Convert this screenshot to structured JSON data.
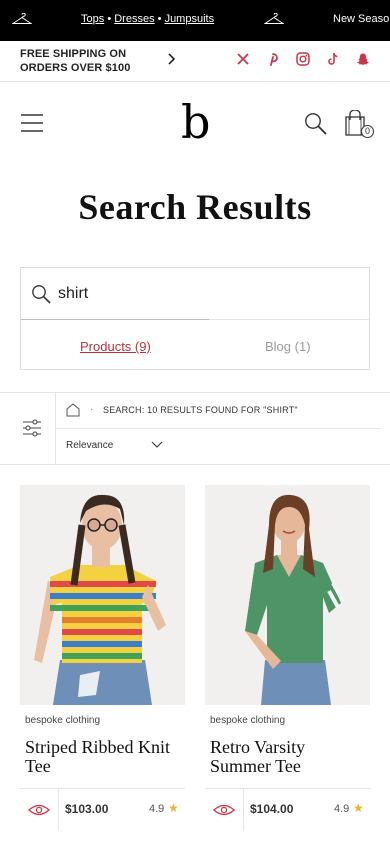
{
  "ticker": {
    "links": [
      "Tops",
      "Dresses",
      "Jumpsuits"
    ],
    "separator": "•",
    "next_text": "New Season"
  },
  "shipping": {
    "line1": "FREE SHIPPING ON",
    "line2": "ORDERS OVER $100"
  },
  "social": [
    "x-icon",
    "pinterest-icon",
    "instagram-icon",
    "tiktok-icon",
    "snapchat-icon"
  ],
  "header": {
    "logo": "b",
    "bag_count": "0"
  },
  "page": {
    "title": "Search Results"
  },
  "search": {
    "value": "shirt",
    "tabs": [
      {
        "label": "Products (9)",
        "active": true
      },
      {
        "label": "Blog (1)",
        "active": false
      }
    ]
  },
  "filter": {
    "breadcrumb_separator": "·",
    "breadcrumb": "SEARCH: 10 RESULTS FOUND FOR \"SHIRT\"",
    "sort": "Relevance"
  },
  "products": [
    {
      "brand": "bespoke clothing",
      "name": "Striped Ribbed Knit Tee",
      "price": "$103.00",
      "rating": "4.9"
    },
    {
      "brand": "bespoke clothing",
      "name": "Retro Varsity Summer Tee",
      "price": "$104.00",
      "rating": "4.9"
    }
  ],
  "colors": {
    "accent": "#b5343b",
    "star": "#f0b429",
    "ticker_bg": "#000000"
  }
}
